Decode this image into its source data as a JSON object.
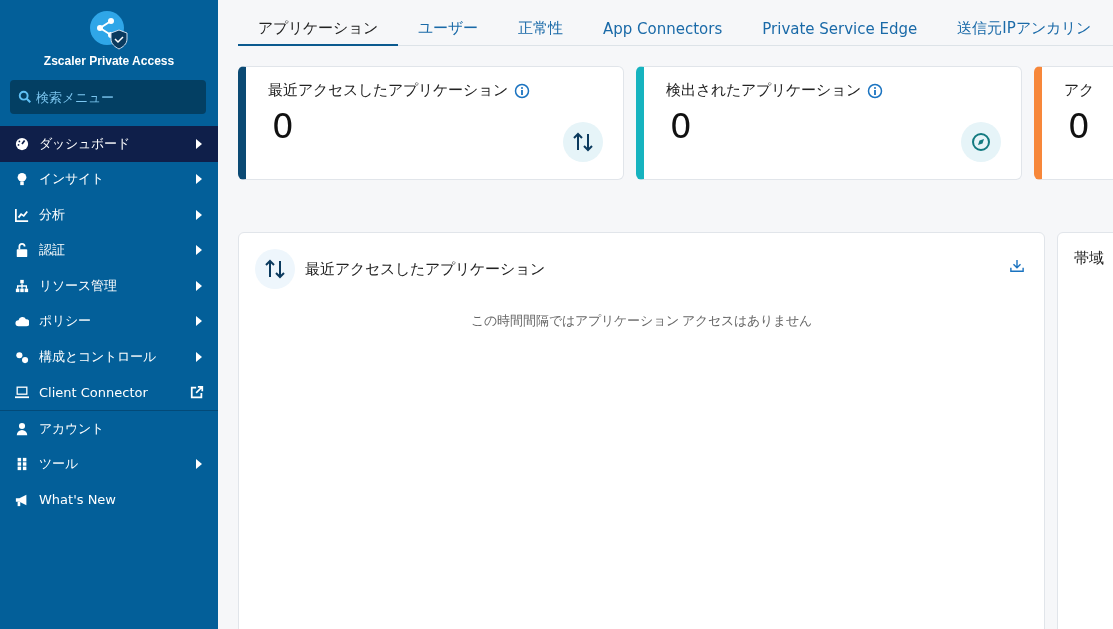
{
  "sidebar": {
    "product": "Zscaler Private Access",
    "search": {
      "placeholder": "検索メニュー"
    },
    "sections": [
      [
        {
          "label": "ダッシュボード",
          "kind": "submenu",
          "selected": true
        },
        {
          "label": "インサイト",
          "kind": "submenu",
          "selected": false
        },
        {
          "label": "分析",
          "kind": "submenu",
          "selected": false
        },
        {
          "label": "認証",
          "kind": "submenu",
          "selected": false
        },
        {
          "label": "リソース管理",
          "kind": "submenu",
          "selected": false
        },
        {
          "label": "ポリシー",
          "kind": "submenu",
          "selected": false
        },
        {
          "label": "構成とコントロール",
          "kind": "submenu",
          "selected": false
        },
        {
          "label": "Client Connector",
          "kind": "external",
          "selected": false
        }
      ],
      [
        {
          "label": "アカウント",
          "kind": "plain",
          "selected": false
        },
        {
          "label": "ツール",
          "kind": "submenu",
          "selected": false
        },
        {
          "label": "What's New",
          "kind": "plain",
          "selected": false
        }
      ]
    ]
  },
  "tabs": [
    {
      "label": "アプリケーション",
      "selected": true
    },
    {
      "label": "ユーザー",
      "selected": false
    },
    {
      "label": "正常性",
      "selected": false
    },
    {
      "label": "App Connectors",
      "selected": false
    },
    {
      "label": "Private Service Edge",
      "selected": false
    },
    {
      "label": "送信元IPアンカリン",
      "selected": false
    }
  ],
  "stat_cards": [
    {
      "title": "最近アクセスしたアプリケーション",
      "value": "0",
      "color": "#0b4a74"
    },
    {
      "title": "検出されたアプリケーション",
      "value": "0",
      "color": "#16b3bf"
    },
    {
      "title": "アク",
      "value": "0",
      "color": "#f7873a"
    }
  ],
  "panels": [
    {
      "title": "最近アクセスしたアプリケーション",
      "message": "この時間間隔ではアプリケーション アクセスはありません"
    },
    {
      "title": "帯域"
    }
  ]
}
